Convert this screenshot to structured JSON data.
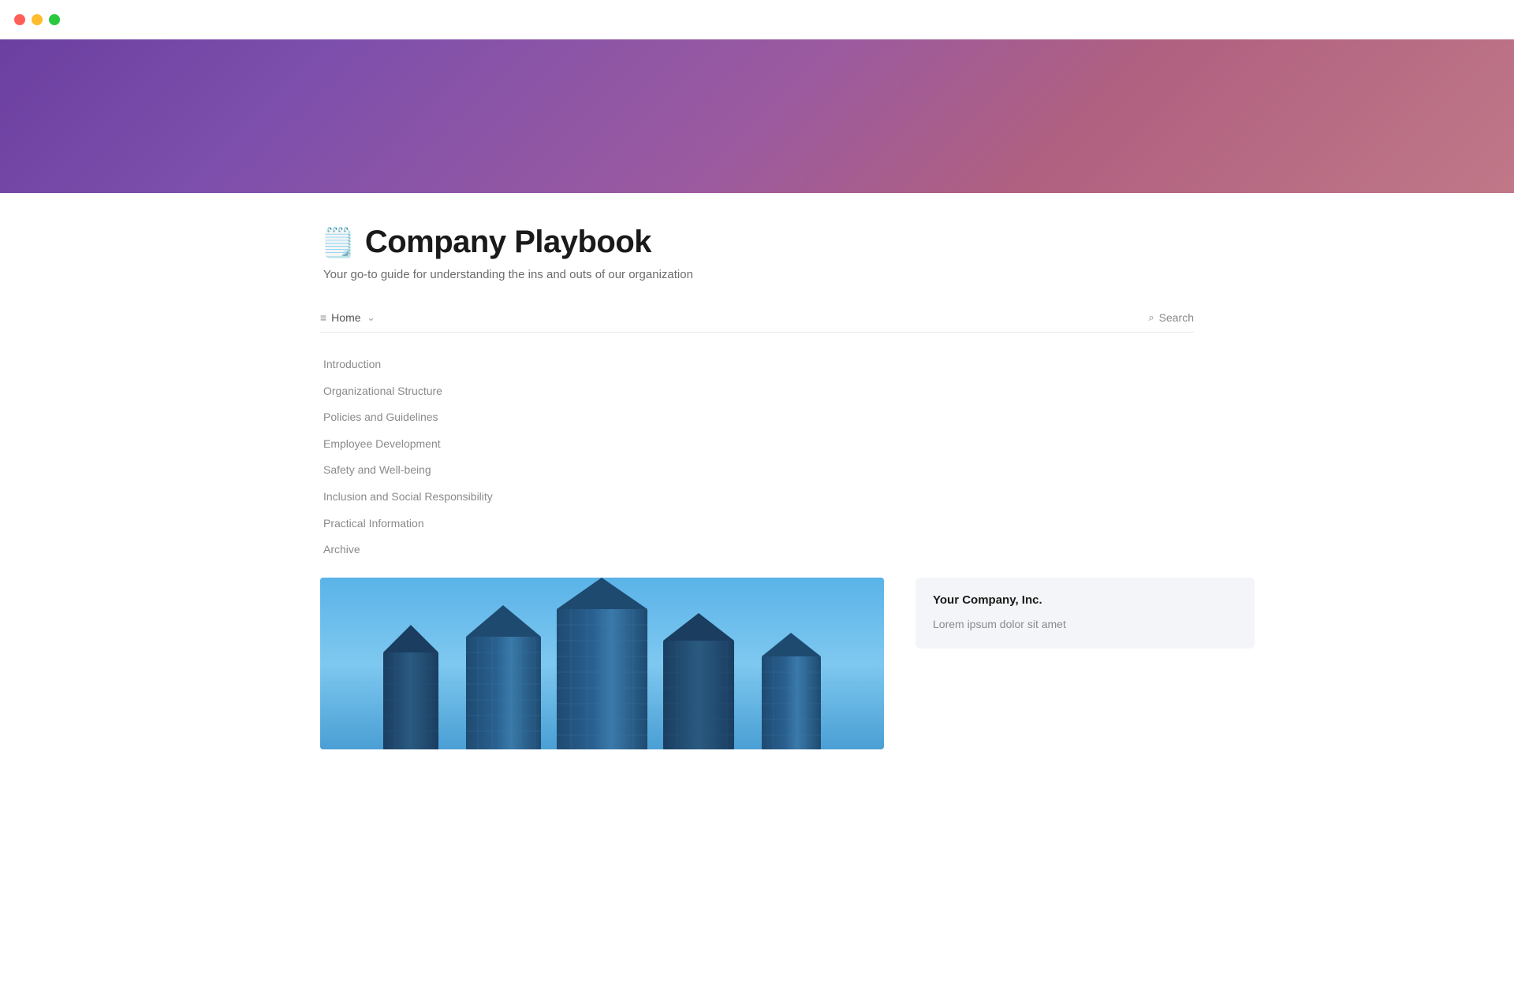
{
  "window": {
    "traffic_lights": {
      "red_label": "close",
      "yellow_label": "minimize",
      "green_label": "maximize"
    }
  },
  "header": {
    "gradient_colors": {
      "start": "#6b3fa0",
      "end": "#c07888"
    }
  },
  "page": {
    "emoji": "🗒️",
    "title": "Company Playbook",
    "subtitle": "Your go-to guide for understanding the ins and outs of our organization"
  },
  "navigation": {
    "home_label": "Home",
    "chevron": "∨",
    "search_label": "Search",
    "search_placeholder": "Search"
  },
  "nav_items": [
    {
      "label": "Introduction"
    },
    {
      "label": "Organizational Structure"
    },
    {
      "label": "Policies and Guidelines"
    },
    {
      "label": "Employee Development"
    },
    {
      "label": "Safety and Well-being"
    },
    {
      "label": "Inclusion and Social Responsibility"
    },
    {
      "label": "Practical Information"
    },
    {
      "label": "Archive"
    }
  ],
  "company_card": {
    "name": "Your Company, Inc.",
    "description": "Lorem ipsum dolor sit amet"
  },
  "icons": {
    "list_icon": "≡",
    "search_icon": "🔍"
  }
}
